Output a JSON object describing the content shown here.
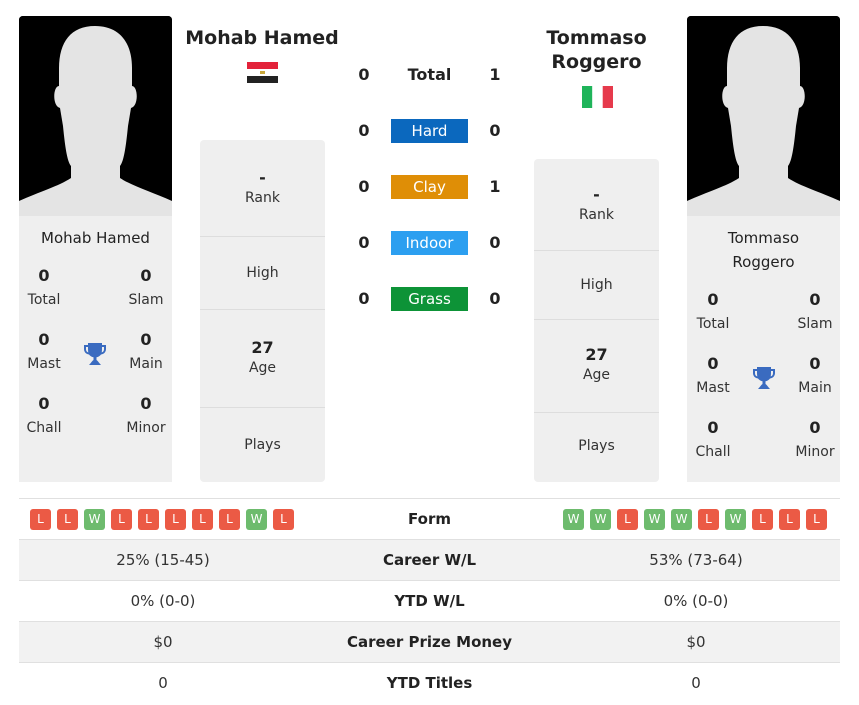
{
  "player1": {
    "name": "Mohab Hamed",
    "flag": "egypt-flag",
    "titles": [
      {
        "value": "0",
        "label": "Total"
      },
      {
        "value": "0",
        "label": "Slam"
      },
      {
        "value": "0",
        "label": "Mast"
      },
      {
        "value": "0",
        "label": "Main"
      },
      {
        "value": "0",
        "label": "Chall"
      },
      {
        "value": "0",
        "label": "Minor"
      }
    ],
    "info": {
      "rank_value": "-",
      "rank_label": "Rank",
      "high_label": "High",
      "age_value": "27",
      "age_label": "Age",
      "plays_label": "Plays"
    },
    "form": [
      "L",
      "L",
      "W",
      "L",
      "L",
      "L",
      "L",
      "L",
      "W",
      "L"
    ]
  },
  "player2": {
    "name_line1": "Tommaso",
    "name_line2": "Roggero",
    "flag": "italy-flag",
    "titles": [
      {
        "value": "0",
        "label": "Total"
      },
      {
        "value": "0",
        "label": "Slam"
      },
      {
        "value": "0",
        "label": "Mast"
      },
      {
        "value": "0",
        "label": "Main"
      },
      {
        "value": "0",
        "label": "Chall"
      },
      {
        "value": "0",
        "label": "Minor"
      }
    ],
    "info": {
      "rank_value": "-",
      "rank_label": "Rank",
      "high_label": "High",
      "age_value": "27",
      "age_label": "Age",
      "plays_label": "Plays"
    },
    "form": [
      "W",
      "W",
      "L",
      "W",
      "W",
      "L",
      "W",
      "L",
      "L",
      "L"
    ]
  },
  "h2h": [
    {
      "label": "Total",
      "p1": "0",
      "p2": "1",
      "color": null
    },
    {
      "label": "Hard",
      "p1": "0",
      "p2": "0",
      "color": "#0b68be"
    },
    {
      "label": "Clay",
      "p1": "0",
      "p2": "1",
      "color": "#df8e06"
    },
    {
      "label": "Indoor",
      "p1": "0",
      "p2": "0",
      "color": "#2c9ff0"
    },
    {
      "label": "Grass",
      "p1": "0",
      "p2": "0",
      "color": "#0d9337"
    }
  ],
  "table": [
    {
      "label": "Form",
      "p1": "",
      "p2": ""
    },
    {
      "label": "Career W/L",
      "p1": "25% (15-45)",
      "p2": "53% (73-64)"
    },
    {
      "label": "YTD W/L",
      "p1": "0% (0-0)",
      "p2": "0% (0-0)"
    },
    {
      "label": "Career Prize Money",
      "p1": "$0",
      "p2": "$0"
    },
    {
      "label": "YTD Titles",
      "p1": "0",
      "p2": "0"
    }
  ]
}
